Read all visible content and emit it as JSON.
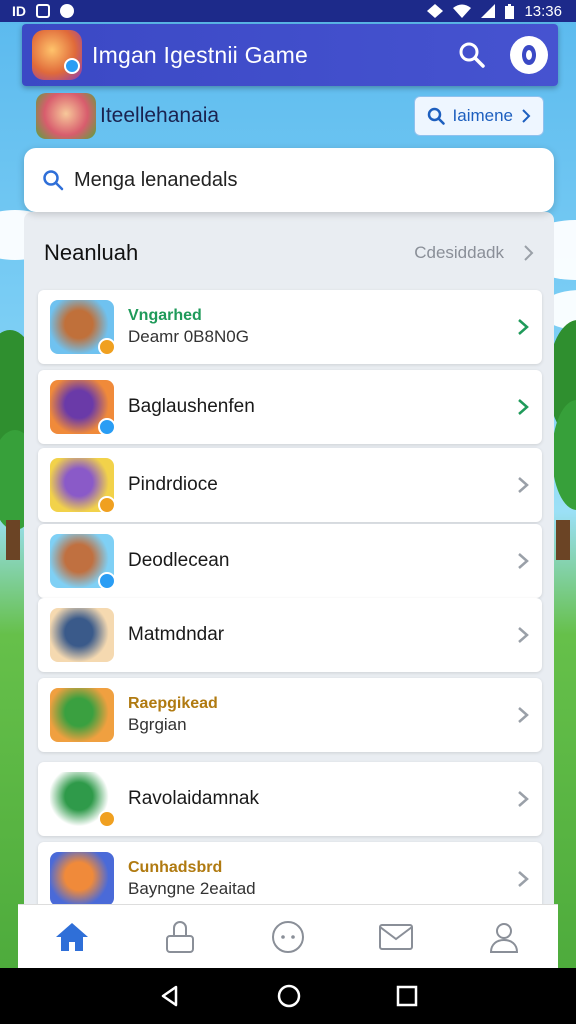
{
  "status": {
    "time": "13:36"
  },
  "app": {
    "title": "Imgan Igestnii Game"
  },
  "subheader": {
    "title": "Iteellehanaia",
    "button_label": "Iaimene"
  },
  "search": {
    "text": "Menga lenanedals"
  },
  "section": {
    "title": "Neanluah",
    "link": "Cdesiddadk"
  },
  "rows": [
    {
      "title": "Vngarhed",
      "subtitle": "Deamr 0B8N0G",
      "title_color": "#1f9a5a",
      "chevron_color": "#1f9a5a",
      "thumb_colors": [
        "#6fc2f0",
        "#c0703a"
      ],
      "badge_color": "#f0a020"
    },
    {
      "title": "Baglaushenfen",
      "subtitle": "",
      "title_color": "#1a1a1a",
      "chevron_color": "#1f9a5a",
      "thumb_colors": [
        "#f08a3a",
        "#6a3aa8"
      ],
      "badge_color": "#2a9df4"
    },
    {
      "title": "Pindrdioce",
      "subtitle": "",
      "title_color": "#1a1a1a",
      "chevron_color": "#9aa0a8",
      "thumb_colors": [
        "#f2d24a",
        "#8a5ac8"
      ],
      "badge_color": "#f0a020"
    },
    {
      "title": "Deodlecean",
      "subtitle": "",
      "title_color": "#1a1a1a",
      "chevron_color": "#9aa0a8",
      "thumb_colors": [
        "#7fd0f5",
        "#c07040"
      ],
      "badge_color": "#2a9df4"
    },
    {
      "title": "Matmdndar",
      "subtitle": "",
      "title_color": "#1a1a1a",
      "chevron_color": "#9aa0a8",
      "thumb_colors": [
        "#f5d9b0",
        "#3a5a8a"
      ],
      "badge_color": ""
    },
    {
      "title": "Raepgikead",
      "subtitle": "Bgrgian",
      "title_color": "#b07a10",
      "chevron_color": "#9aa0a8",
      "thumb_colors": [
        "#f0a040",
        "#3aa040"
      ],
      "badge_color": ""
    },
    {
      "title": "Ravolaidamnak",
      "subtitle": "",
      "title_color": "#1a1a1a",
      "chevron_color": "#9aa0a8",
      "thumb_colors": [
        "#ffffff",
        "#2f9a4a"
      ],
      "badge_color": "#f0a020"
    },
    {
      "title": "Cunhadsbrd",
      "subtitle": "Bayngne 2eaitad",
      "title_color": "#b07a10",
      "chevron_color": "#9aa0a8",
      "thumb_colors": [
        "#4a6ad8",
        "#f08a3a"
      ],
      "badge_color": ""
    }
  ],
  "nav": [
    "home-icon",
    "store-icon",
    "chat-icon",
    "mail-icon",
    "profile-icon"
  ],
  "colors": {
    "accent": "#3b49c5",
    "nav_active": "#2f6fd8",
    "nav_inactive": "#8a8f98"
  }
}
